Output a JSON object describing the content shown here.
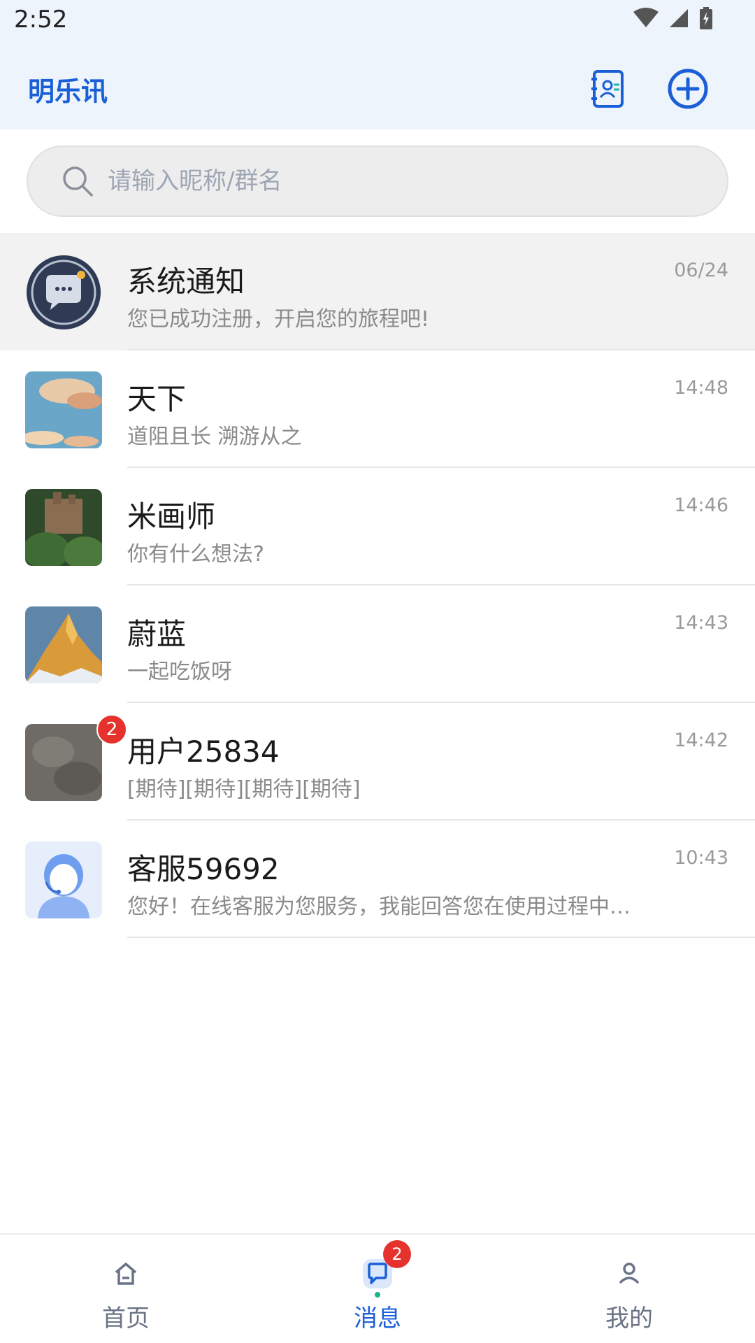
{
  "status_bar": {
    "time": "2:52"
  },
  "header": {
    "title": "明乐讯",
    "contacts_icon": "contacts-book-icon",
    "add_icon": "add-circle-icon",
    "accent": "#1a5fd8"
  },
  "search": {
    "placeholder": "请输入昵称/群名",
    "value": ""
  },
  "conversations": [
    {
      "name": "系统通知",
      "message": "您已成功注册，开启您的旅程吧!",
      "time": "06/24",
      "badge": ""
    },
    {
      "name": "天下",
      "message": "道阻且长 溯游从之",
      "time": "14:48",
      "badge": ""
    },
    {
      "name": "米画师",
      "message": "你有什么想法?",
      "time": "14:46",
      "badge": ""
    },
    {
      "name": "蔚蓝",
      "message": "一起吃饭呀",
      "time": "14:43",
      "badge": ""
    },
    {
      "name": "用户25834",
      "message": "[期待][期待][期待][期待]",
      "time": "14:42",
      "badge": "2"
    },
    {
      "name": "客服59692",
      "message": "您好！在线客服为您服务，我能回答您在使用过程中…",
      "time": "10:43",
      "badge": ""
    }
  ],
  "bottom_nav": {
    "items": [
      {
        "label": "首页",
        "icon": "home-icon"
      },
      {
        "label": "消息",
        "icon": "chat-bubble-icon",
        "badge": "2",
        "active": true
      },
      {
        "label": "我的",
        "icon": "person-icon"
      }
    ]
  }
}
